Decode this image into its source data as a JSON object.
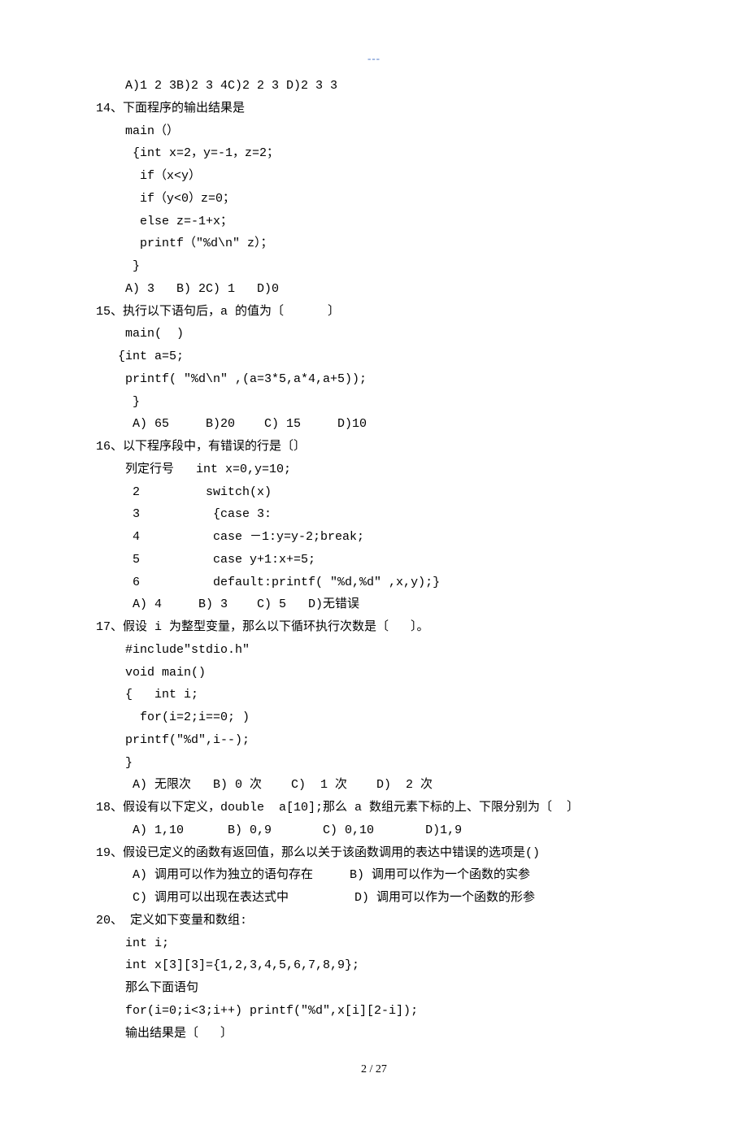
{
  "header": {
    "mark": "---"
  },
  "q13": {
    "options": "    A)1 2 3B)2 3 4C)2 2 3 D)2 3 3"
  },
  "q14": {
    "stem": "14、下面程序的输出结果是",
    "c1": "    main（）",
    "c2": "     {int x=2，y=-1，z=2；",
    "c3": "      if（x<y）",
    "c4": "      if（y<0）z=0；",
    "c5": "      else z=-1+x；",
    "c6": "      printf（\"%d\\n\" z）；",
    "c7": "     }",
    "opts": "    A) 3   B) 2C) 1   D)0"
  },
  "q15": {
    "stem": "15、执行以下语句后，a 的值为〔      〕",
    "c1": "    main(  )",
    "c2": "   {int a=5;",
    "c3": "    printf( \"%d\\n\" ,(a=3*5,a*4,a+5));",
    "c4": "     }",
    "opts": "     A) 65     B)20    C) 15     D)10"
  },
  "q16": {
    "stem": "16、以下程序段中，有错误的行是〔〕",
    "c1": "    列定行号   int x=0,y=10;",
    "c2": "     2         switch(x)",
    "c3": "     3          {case 3:",
    "c4": "     4          case －1:y=y-2;break;",
    "c5": "     5          case y+1:x+=5;",
    "c6": "     6          default:printf( \"%d,%d\" ,x,y);}",
    "opts": "     A) 4     B) 3    C) 5   D)无错误"
  },
  "q17": {
    "stem": "17、假设 i 为整型变量，那么以下循环执行次数是〔   〕。",
    "c1": "    #include\"stdio.h\"",
    "c2": "    void main()",
    "c3": "    {   int i;",
    "c4": "      for(i=2;i==0; )",
    "c5": "    printf(\"%d\",i--);",
    "c6": "    }",
    "opts": "     A) 无限次   B) 0 次    C)  1 次    D)  2 次"
  },
  "q18": {
    "stem": "18、假设有以下定义，double  a[10];那么 a 数组元素下标的上、下限分别为〔  〕",
    "opts": "     A) 1,10      B) 0,9       C) 0,10       D)1,9"
  },
  "q19": {
    "stem": "19、假设已定义的函数有返回值，那么以关于该函数调用的表达中错误的选项是()",
    "o1": "     A) 调用可以作为独立的语句存在     B) 调用可以作为一个函数的实参",
    "o2": "     C) 调用可以出现在表达式中         D) 调用可以作为一个函数的形参"
  },
  "q20": {
    "stem": "20、 定义如下变量和数组:",
    "c1": "    int i;",
    "c2": "    int x[3][3]={1,2,3,4,5,6,7,8,9};",
    "c3": "    那么下面语句",
    "c4": "    for(i=0;i<3;i++) printf(\"%d\",x[i][2-i]);",
    "c5": "    输出结果是〔   〕"
  },
  "footer": {
    "pagenum": "2 / 27"
  }
}
